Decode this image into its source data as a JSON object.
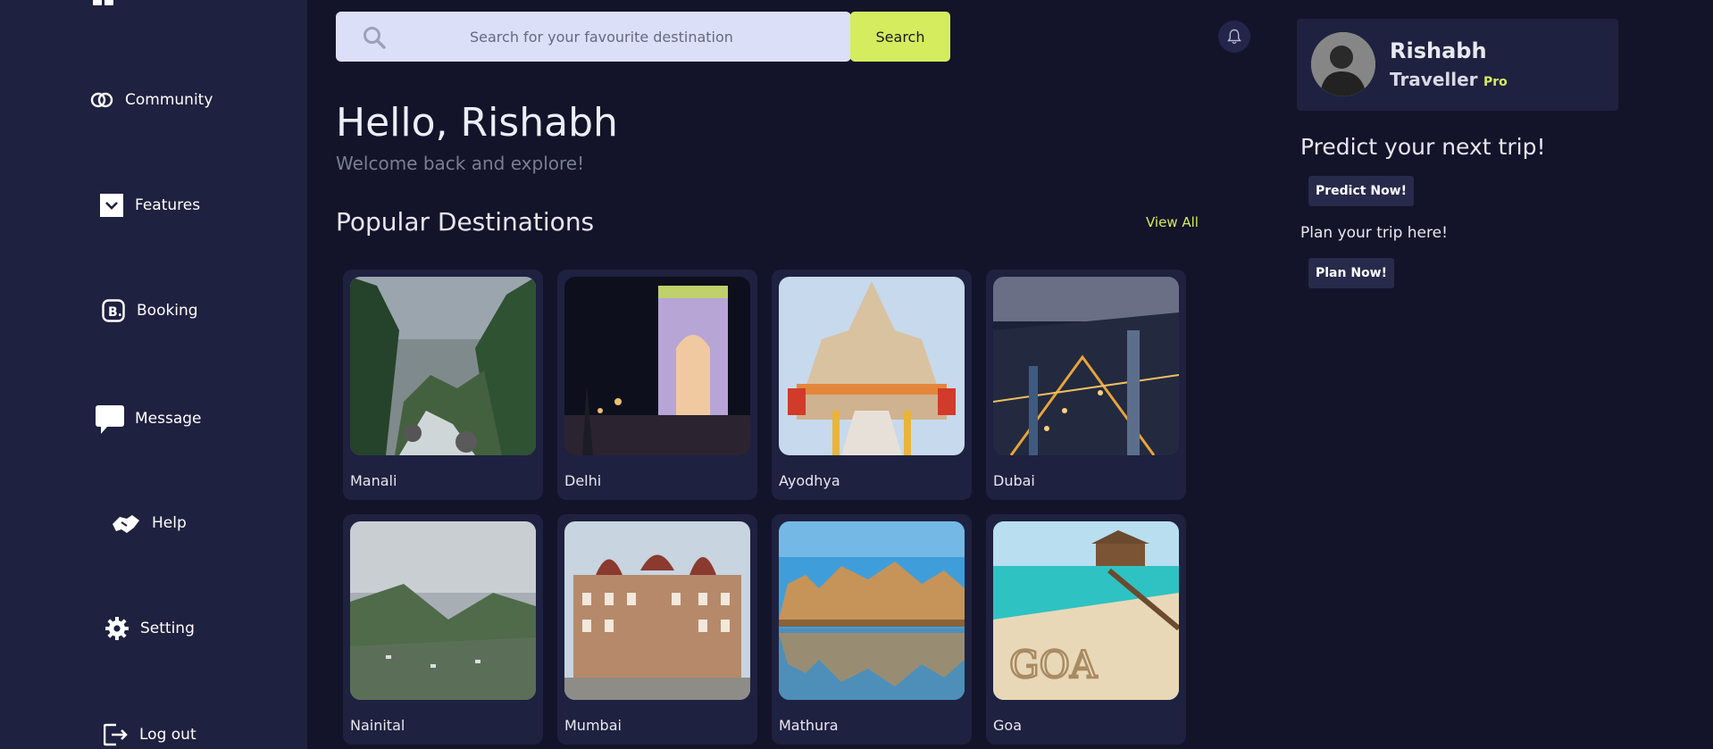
{
  "sidebar": {
    "items": [
      {
        "label": "Community",
        "icon": "community-icon"
      },
      {
        "label": "Features",
        "icon": "chevron-down-icon"
      },
      {
        "label": "Booking",
        "icon": "booking-icon"
      },
      {
        "label": "Message",
        "icon": "message-icon"
      },
      {
        "label": "Help",
        "icon": "help-handshake-icon"
      },
      {
        "label": "Setting",
        "icon": "gear-icon"
      },
      {
        "label": "Log out",
        "icon": "logout-icon"
      }
    ]
  },
  "search": {
    "placeholder": "Search for your favourite destination",
    "button_label": "Search"
  },
  "main": {
    "greeting": "Hello, Rishabh",
    "subtitle": "Welcome back and explore!",
    "section_title": "Popular Destinations",
    "view_all": "View All",
    "destinations": [
      {
        "name": "Manali"
      },
      {
        "name": "Delhi"
      },
      {
        "name": "Ayodhya"
      },
      {
        "name": "Dubai"
      },
      {
        "name": "Nainital"
      },
      {
        "name": "Mumbai"
      },
      {
        "name": "Mathura"
      },
      {
        "name": "Goa"
      }
    ]
  },
  "profile": {
    "name": "Rishabh",
    "role": "Traveller",
    "badge": "Pro"
  },
  "panel": {
    "predict_title": "Predict your next trip!",
    "predict_button": "Predict Now!",
    "plan_text": "Plan your trip here!",
    "plan_button": "Plan Now!"
  },
  "colors": {
    "background": "#13142a",
    "sidebar": "#1f2140",
    "accent": "#d4ec5e",
    "search_field": "#dcdff8"
  }
}
